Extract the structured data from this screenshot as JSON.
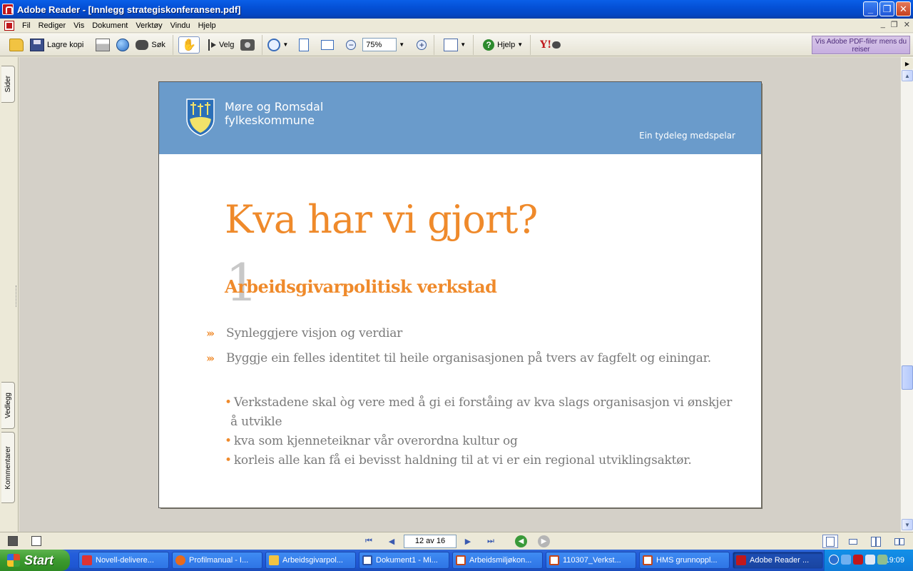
{
  "window": {
    "title": "Adobe Reader - [Innlegg strategiskonferansen.pdf]",
    "minimize": "_",
    "restore": "❐",
    "close": "✕"
  },
  "menubar": {
    "items": [
      "Fil",
      "Rediger",
      "Vis",
      "Dokument",
      "Verktøy",
      "Vindu",
      "Hjelp"
    ],
    "doc_controls": [
      "_",
      "❐",
      "✕"
    ]
  },
  "toolbar": {
    "save_copy_label": "Lagre kopi",
    "search_label": "Søk",
    "select_label": "Velg",
    "zoom_value": "75%",
    "help_label": "Hjelp",
    "yahoo_label": "Y!",
    "ad_text": "Vis Adobe PDF-filer mens du reiser"
  },
  "sidepanel": {
    "tabs": [
      "Sider",
      "Vedlegg",
      "Kommentarer"
    ]
  },
  "slide": {
    "org_name_line1": "Møre og Romsdal",
    "org_name_line2": "fylkeskommune",
    "tagline": "Ein tydeleg medspelar",
    "title": "Kva har vi gjort?",
    "number": "1",
    "subtitle": "Arbeidsgivarpolitisk verkstad",
    "chevron": "›››",
    "bullets": [
      "Synleggjere visjon og verdiar",
      "Byggje ein felles  identitet til heile organisasjonen på tvers av fagfelt og einingar."
    ],
    "sub_bullets": [
      "Verkstadene skal òg vere med å gi ei forståing av kva slags organisasjon vi ønskjer",
      "å utvikle",
      "kva som kjenneteiknar vår overordna kultur og",
      "korleis alle kan få ei bevisst haldning til at vi er ein regional utviklingsaktør."
    ],
    "dot": "•"
  },
  "statusbar": {
    "page_indicator": "12 av 16"
  },
  "taskbar": {
    "start_label": "Start",
    "tasks": [
      "Novell-delivere...",
      "Profilmanual - I...",
      "Arbeidsgivarpol...",
      "Dokument1 - Mi...",
      "Arbeidsmiljøkon...",
      "110307_Verkst...",
      "HMS grunnoppl...",
      "Adobe Reader ..."
    ],
    "clock": "19:09"
  }
}
